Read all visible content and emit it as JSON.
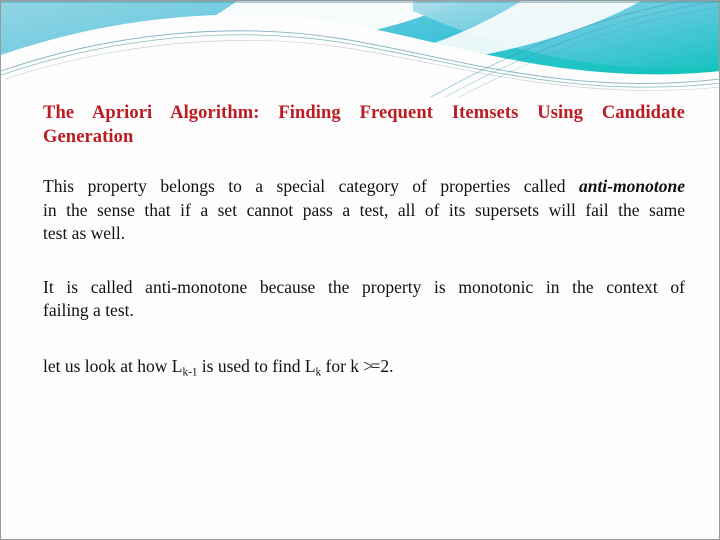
{
  "slide": {
    "title_line1": "The Apriori Algorithm: Finding Frequent Itemsets Using Candidate",
    "title_line2": "Generation",
    "title_color": "#bd1a22",
    "body_color": "#111111"
  },
  "banner": {
    "name": "wave-banner",
    "gradient_from": "#8ed2e4",
    "gradient_mid": "#4ec4da",
    "gradient_to": "#19c5c0",
    "accent_line": "#4a8fa0",
    "accent_line_2": "#2b8f8a"
  },
  "paragraph1": {
    "line1_a": "This property belongs to a special category of properties called ",
    "line1_b": "anti-monotone",
    "line2": "in the sense that if a set cannot pass a test, all of its supersets will fail the same",
    "line3": "test as well."
  },
  "paragraph2": {
    "line1": "It is called anti-monotone because the property is monotonic in the context of",
    "line2": "failing a test."
  },
  "paragraph3": {
    "part1": "let us look at how L",
    "sub1": "k-1",
    "part2": " is used to find L",
    "sub2": "k",
    "part3": " for k ",
    "operator": ">=",
    "part4": "2."
  }
}
